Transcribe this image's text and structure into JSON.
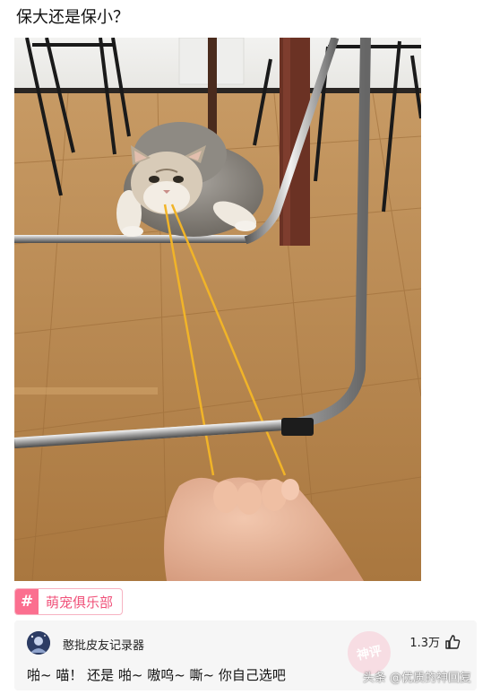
{
  "post": {
    "title": "保大还是保小？"
  },
  "photo": {
    "description_icon": "cat-photo"
  },
  "tag": {
    "hash_symbol": "#",
    "label": "萌宠俱乐部"
  },
  "comment": {
    "username": "憨批皮友记录器",
    "likes": "1.3万",
    "text": "啪~ 喵！ 还是 啪~ 嗷呜~ 嘶~ 你自己选吧",
    "stamp_text": "神评"
  },
  "watermark": {
    "text": "头条 @优质的神回复"
  },
  "colors": {
    "accent_pink": "#fb6f8f",
    "tag_text": "#f0527a",
    "comment_bg": "#f6f6f6"
  }
}
